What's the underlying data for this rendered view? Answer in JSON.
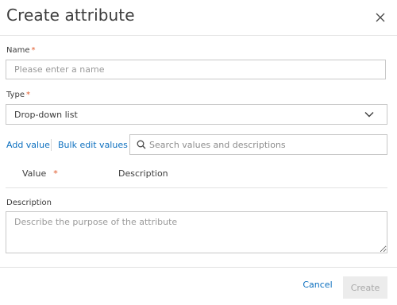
{
  "dialog": {
    "title": "Create attribute",
    "close_icon": "close-icon"
  },
  "name_field": {
    "label": "Name",
    "required_mark": "*",
    "placeholder": "Please enter a name",
    "value": ""
  },
  "type_field": {
    "label": "Type",
    "required_mark": "*",
    "selected_value": "Drop-down list",
    "icon": "chevron-down-icon"
  },
  "values_toolbar": {
    "add_value_label": "Add value",
    "bulk_edit_label": "Bulk edit values",
    "search_placeholder": "Search values and descriptions",
    "search_icon": "search-icon"
  },
  "values_table": {
    "columns": [
      {
        "label": "Value",
        "required_mark": "*"
      },
      {
        "label": "Description"
      }
    ]
  },
  "description_field": {
    "label": "Description",
    "placeholder": "Describe the purpose of the attribute",
    "value": ""
  },
  "footer": {
    "cancel_label": "Cancel",
    "create_label": "Create"
  },
  "colors": {
    "link": "#0b6fbf",
    "required": "#e0592a",
    "disabled_bg": "#ececec",
    "disabled_text": "#a8a8a8",
    "border": "#c8c8c8"
  }
}
